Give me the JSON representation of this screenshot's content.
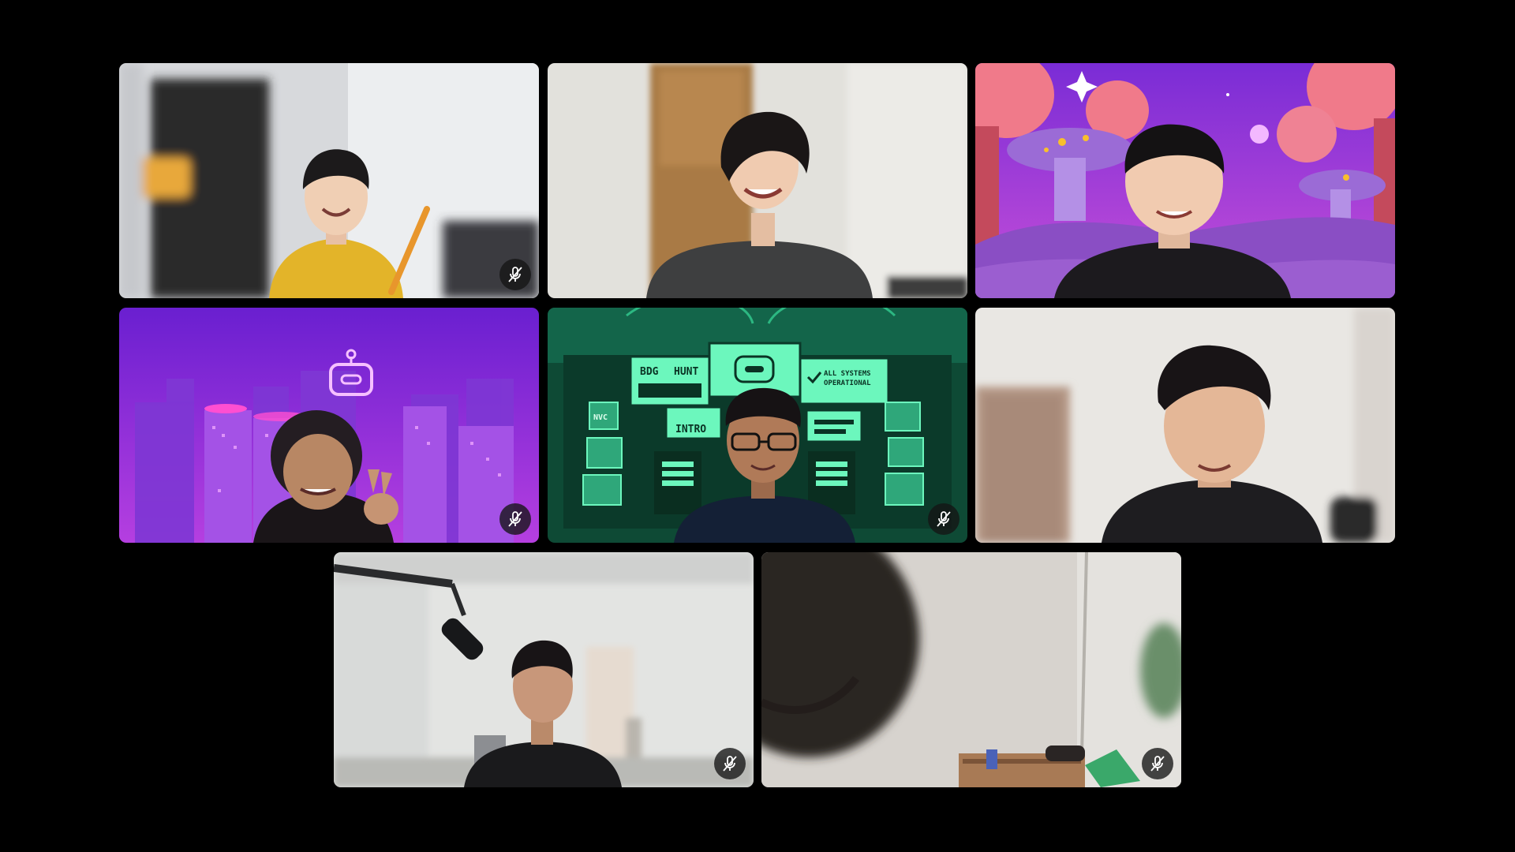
{
  "meeting": {
    "tiles": [
      {
        "id": "p1",
        "muted": true,
        "background": "room-light"
      },
      {
        "id": "p2",
        "muted": false,
        "background": "room-door"
      },
      {
        "id": "p3",
        "muted": false,
        "background": "virtual-mushroom-world"
      },
      {
        "id": "p4",
        "muted": true,
        "background": "virtual-neon-city"
      },
      {
        "id": "p5",
        "muted": true,
        "background": "virtual-bdg-hunt-control-room"
      },
      {
        "id": "p6",
        "muted": false,
        "background": "room-white-wall"
      },
      {
        "id": "p7",
        "muted": true,
        "background": "room-microphone"
      },
      {
        "id": "p8",
        "muted": true,
        "background": "room-ceiling"
      }
    ],
    "mute_icon": "microphone-off-icon",
    "bg_screen_text": {
      "hunt_left": "BDG",
      "hunt_right": "HUNT",
      "status_line1": "ALL SYSTEMS",
      "status_line2": "OPERATIONAL",
      "intro": "INTRO",
      "nvc": "NVC"
    },
    "colors": {
      "stage_bg": "#000000",
      "mute_badge_bg": "#141414",
      "neon_green": "#3ef0a8",
      "neon_purple": "#b04cff"
    }
  }
}
